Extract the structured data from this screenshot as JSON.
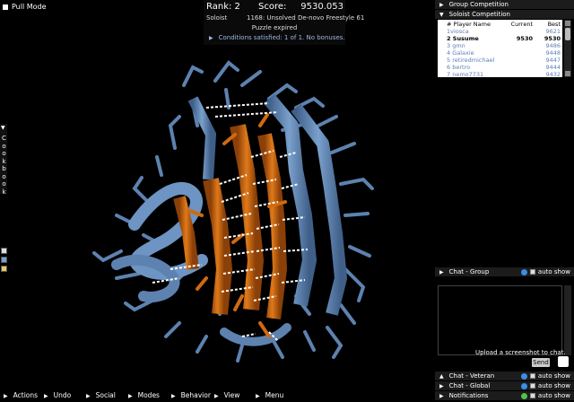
{
  "pull_mode": {
    "label": "Pull Mode"
  },
  "score_panel": {
    "rank": "Rank: 2",
    "score_label": "Score:",
    "score_value": "9530.053",
    "role": "Soloist",
    "puzzle": "1168: Unsolved De-novo Freestyle 61",
    "status": "Puzzle expired",
    "conditions": "Conditions satisfied: 1 of 1. No bonuses."
  },
  "right_panel": {
    "group_competition": "Group Competition",
    "soloist_competition": "Soloist Competition",
    "leaderboard": {
      "headers": {
        "player": "# Player Name",
        "current": "Current",
        "best": "Best"
      },
      "rows": [
        {
          "name": "1viosca",
          "current": "",
          "best": "9621"
        },
        {
          "name": "2 Susume",
          "current": "9530",
          "best": "9530",
          "self": true
        },
        {
          "name": "3 gmn",
          "current": "",
          "best": "9486"
        },
        {
          "name": "4 Galaxie",
          "current": "",
          "best": "9448"
        },
        {
          "name": "5 retiredmichael",
          "current": "",
          "best": "9447"
        },
        {
          "name": "6 bertro",
          "current": "",
          "best": "9444"
        },
        {
          "name": "7 nemo7731",
          "current": "",
          "best": "9432"
        }
      ]
    },
    "chat_group": "Chat - Group",
    "auto_show": "auto show",
    "upload_screenshot": "Upload a screenshot to chat.",
    "send": "Send",
    "chat_veteran": "Chat - Veteran",
    "chat_global": "Chat - Global",
    "notifications": "Notifications"
  },
  "cookbook": {
    "label": "Cookbook"
  },
  "bottom_menu": [
    "Actions",
    "Undo",
    "Social",
    "Modes",
    "Behavior",
    "View",
    "Menu"
  ],
  "colors": {
    "helix_blue": "#5d82b0",
    "sheet_orange": "#d06a10",
    "hbond_white": "#ffffff",
    "background": "#000000"
  }
}
